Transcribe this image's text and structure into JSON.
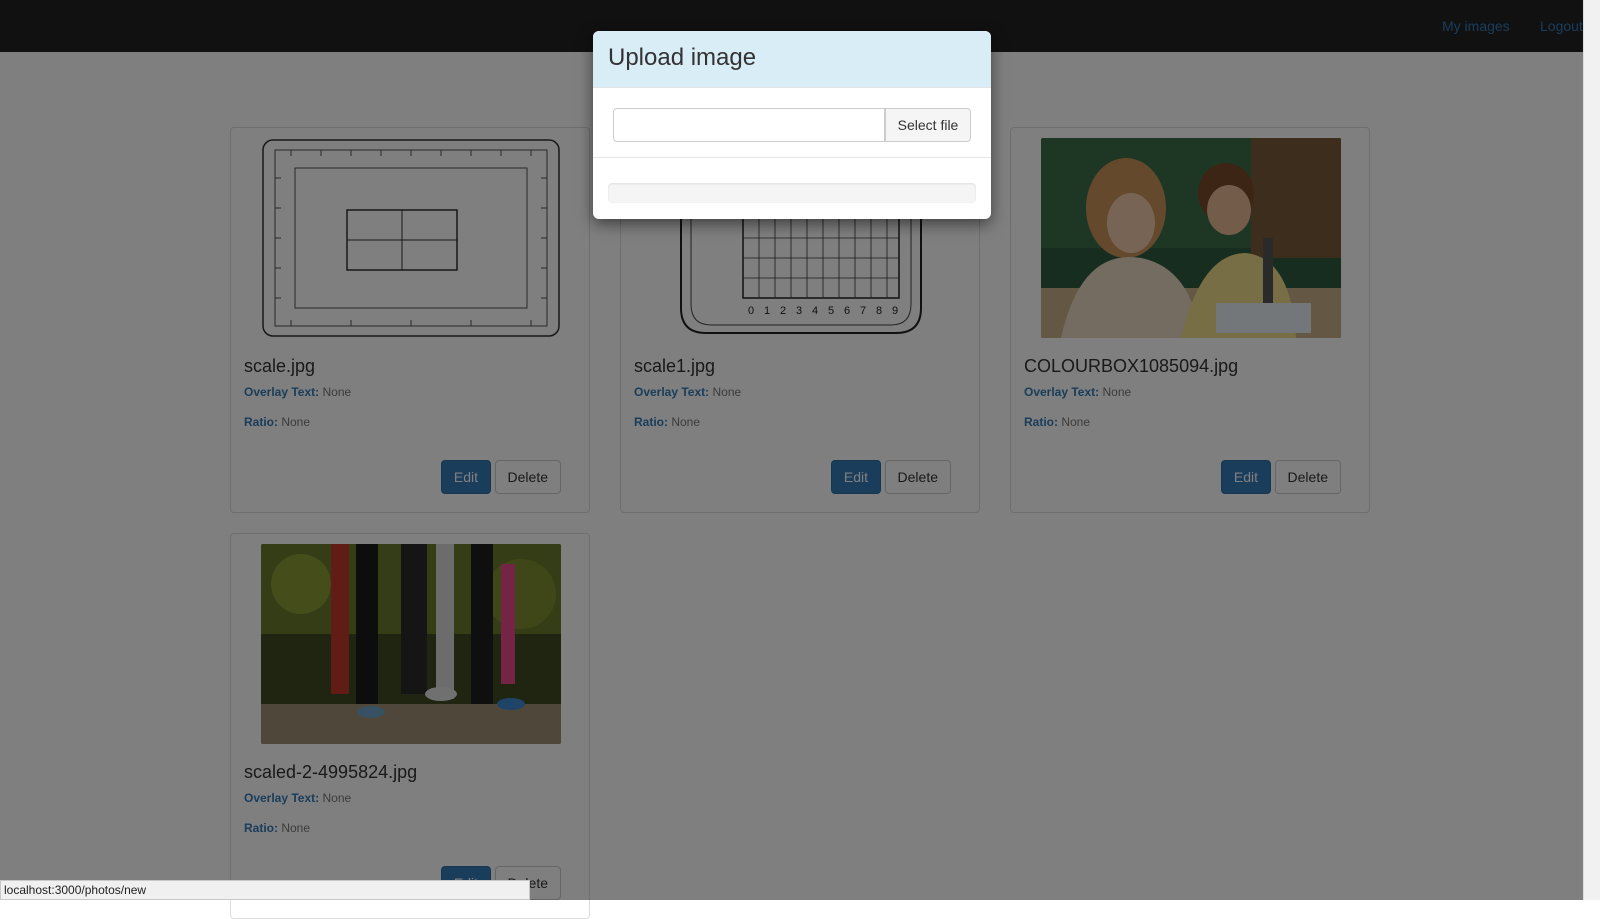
{
  "nav": {
    "my_images": "My images",
    "logout": "Logout"
  },
  "cards": [
    {
      "filename": "scale.jpg",
      "overlay_label": "Overlay Text:",
      "overlay_value": "None",
      "ratio_label": "Ratio:",
      "ratio_value": "None",
      "edit": "Edit",
      "delete": "Delete"
    },
    {
      "filename": "scale1.jpg",
      "overlay_label": "Overlay Text:",
      "overlay_value": "None",
      "ratio_label": "Ratio:",
      "ratio_value": "None",
      "edit": "Edit",
      "delete": "Delete"
    },
    {
      "filename": "COLOURBOX1085094.jpg",
      "overlay_label": "Overlay Text:",
      "overlay_value": "None",
      "ratio_label": "Ratio:",
      "ratio_value": "None",
      "edit": "Edit",
      "delete": "Delete"
    },
    {
      "filename": "scaled-2-4995824.jpg",
      "overlay_label": "Overlay Text:",
      "overlay_value": "None",
      "ratio_label": "Ratio:",
      "ratio_value": "None",
      "edit": "Edit",
      "delete": "Delete"
    }
  ],
  "modal": {
    "title": "Upload image",
    "file_value": "",
    "select_file": "Select file",
    "progress": 0
  },
  "scale_labels": [
    "0",
    "1",
    "2",
    "3",
    "4",
    "5",
    "6",
    "7",
    "8",
    "9"
  ],
  "status_url": "localhost:3000/photos/new",
  "colors": {
    "navbar": "#222222",
    "accent": "#337ab7",
    "modal_header": "#d9edf7"
  }
}
